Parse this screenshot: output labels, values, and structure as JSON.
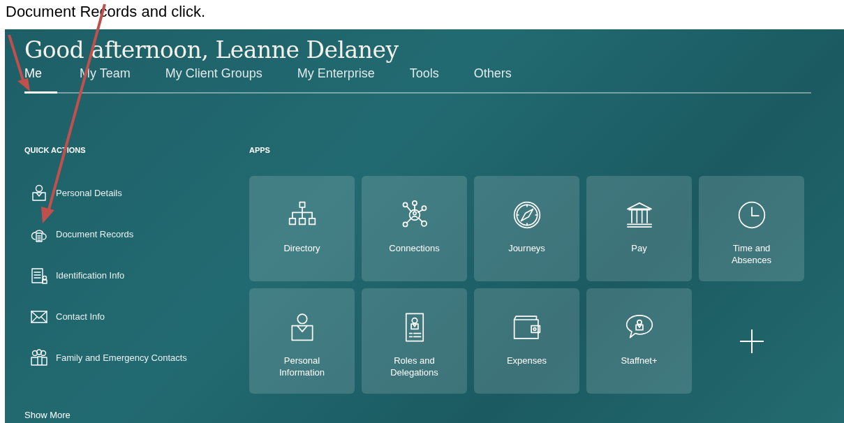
{
  "caption": "Document Records and click.",
  "greeting": "Good afternoon, Leanne Delaney",
  "tabs": [
    {
      "label": "Me",
      "selected": true
    },
    {
      "label": "My Team",
      "selected": false
    },
    {
      "label": "My Client Groups",
      "selected": false
    },
    {
      "label": "My Enterprise",
      "selected": false
    },
    {
      "label": "Tools",
      "selected": false
    },
    {
      "label": "Others",
      "selected": false
    }
  ],
  "quick_actions": {
    "title": "QUICK ACTIONS",
    "items": [
      {
        "label": "Personal Details"
      },
      {
        "label": "Document Records"
      },
      {
        "label": "Identification Info"
      },
      {
        "label": "Contact Info"
      },
      {
        "label": "Family and Emergency Contacts"
      }
    ],
    "show_more": "Show More"
  },
  "apps": {
    "title": "APPS",
    "tiles": [
      {
        "kind": "app",
        "label": "Directory"
      },
      {
        "kind": "app",
        "label": "Connections"
      },
      {
        "kind": "app",
        "label": "Journeys"
      },
      {
        "kind": "app",
        "label": "Pay"
      },
      {
        "kind": "app",
        "label": "Time and Absences"
      },
      {
        "kind": "app",
        "label": "Personal Information"
      },
      {
        "kind": "app",
        "label": "Roles and Delegations"
      },
      {
        "kind": "app",
        "label": "Expenses"
      },
      {
        "kind": "app",
        "label": "Staffnet+"
      },
      {
        "kind": "add"
      }
    ]
  }
}
